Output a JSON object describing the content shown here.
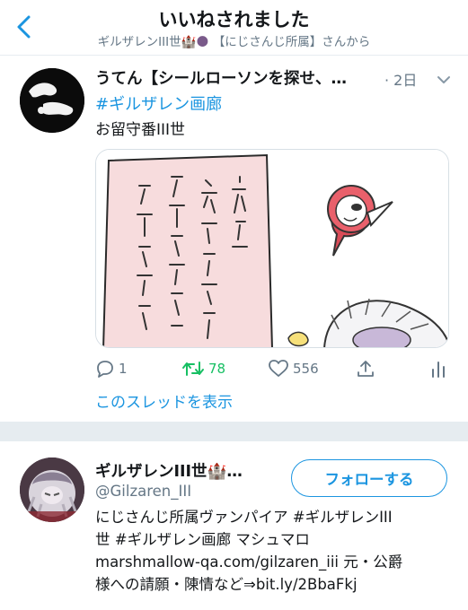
{
  "header": {
    "title": "いいねされました",
    "subtitle_name": "ギルザレンIII世",
    "subtitle_emoji": "🏰🌑",
    "subtitle_affil": "【にじさんじ所属】さんから"
  },
  "tweet": {
    "author_name": "うてん【シールローソンを探せ、…",
    "time": "· 2日",
    "hashtag": "#ギルザレン画廊",
    "text": "お留守番III世",
    "actions": {
      "reply_count": "1",
      "retweet_count": "78",
      "like_count": "556"
    },
    "thread_link": "このスレッドを表示"
  },
  "profile": {
    "name": "ギルザレンIII世🏰…",
    "handle": "@Gilzaren_III",
    "follow_label": "フォローする",
    "bio_line1": "にじさんじ所属ヴァンパイア #ギルザレンIII",
    "bio_line2": "世 #ギルザレン画廊 マシュマロ",
    "bio_line3": "marshmallow-qa.com/gilzaren_iii 元・公爵",
    "bio_line4": "様への請願・陳情など⇒bit.ly/2BbaFkj"
  },
  "colors": {
    "accent": "#1b95e0",
    "retweet": "#17bf63",
    "muted": "#657786",
    "separator": "#e6ecf0"
  }
}
